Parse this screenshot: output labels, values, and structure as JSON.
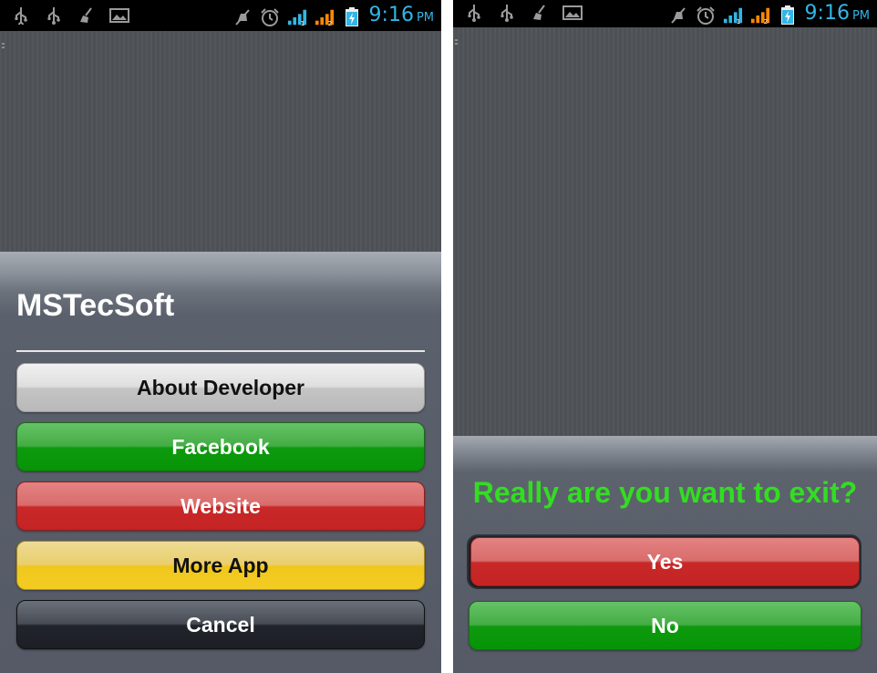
{
  "status_bar": {
    "time": "9:16",
    "ampm": "PM",
    "left_icons": [
      "usb-icon",
      "usb-icon",
      "broom-icon",
      "image-icon"
    ],
    "right_icons": [
      "mute-icon",
      "alarm-icon",
      "signal-1-icon",
      "signal-2-icon",
      "battery-charging-icon"
    ],
    "time_color": "#33b5e5"
  },
  "left_screen": {
    "dialog_title": "MSTecSoft",
    "buttons": [
      {
        "label": "About Developer",
        "style": "gray"
      },
      {
        "label": "Facebook",
        "style": "green"
      },
      {
        "label": "Website",
        "style": "red"
      },
      {
        "label": "More App",
        "style": "yellow"
      },
      {
        "label": "Cancel",
        "style": "dark"
      }
    ]
  },
  "right_screen": {
    "question": "Really are you want to exit?",
    "question_color": "#33dd22",
    "yes_label": "Yes",
    "no_label": "No"
  }
}
